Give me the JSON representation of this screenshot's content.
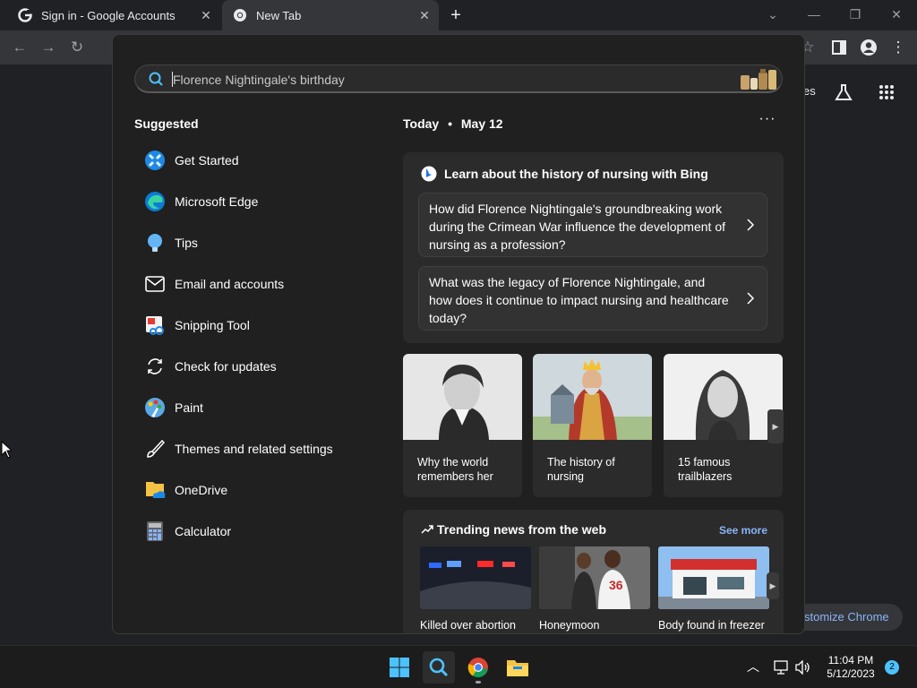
{
  "browser": {
    "tabs": [
      {
        "title": "Sign in - Google Accounts",
        "active": false,
        "icon": "google-g-icon"
      },
      {
        "title": "New Tab",
        "active": true,
        "icon": "chrome-icon"
      }
    ],
    "new_tab_label": "+",
    "page_partial_text": "es",
    "customize_label": "stomize Chrome"
  },
  "flyout": {
    "search": {
      "placeholder": "Florence Nightingale's birthday"
    },
    "suggested": {
      "title": "Suggested",
      "items": [
        {
          "label": "Get Started",
          "icon": "get-started-icon"
        },
        {
          "label": "Microsoft Edge",
          "icon": "edge-icon"
        },
        {
          "label": "Tips",
          "icon": "tips-icon"
        },
        {
          "label": "Email and accounts",
          "icon": "mail-icon"
        },
        {
          "label": "Snipping Tool",
          "icon": "snipping-tool-icon"
        },
        {
          "label": "Check for updates",
          "icon": "refresh-icon"
        },
        {
          "label": "Paint",
          "icon": "paint-icon"
        },
        {
          "label": "Themes and related settings",
          "icon": "brush-icon"
        },
        {
          "label": "OneDrive",
          "icon": "onedrive-icon"
        },
        {
          "label": "Calculator",
          "icon": "calculator-icon"
        }
      ]
    },
    "today": {
      "label": "Today",
      "separator": "•",
      "date": "May 12",
      "more": "···"
    },
    "bing": {
      "title": "Learn about the history of nursing with Bing",
      "questions": [
        "How did Florence Nightingale's groundbreaking work during the Crimean War influence the development of nursing as a profession?",
        "What was the legacy of Florence Nightingale, and how does it continue to impact nursing and healthcare today?"
      ]
    },
    "tiles": [
      {
        "caption": "Why the world remembers her"
      },
      {
        "caption": "The history of nursing"
      },
      {
        "caption": "15 famous trailblazers"
      }
    ],
    "trending": {
      "title": "Trending news from the web",
      "see_more": "See more",
      "items": [
        {
          "caption": "Killed over abortion"
        },
        {
          "caption": "Honeymoon"
        },
        {
          "caption": "Body found in freezer"
        }
      ]
    }
  },
  "taskbar": {
    "time": "11:04 PM",
    "date": "5/12/2023",
    "notification_count": "2"
  }
}
